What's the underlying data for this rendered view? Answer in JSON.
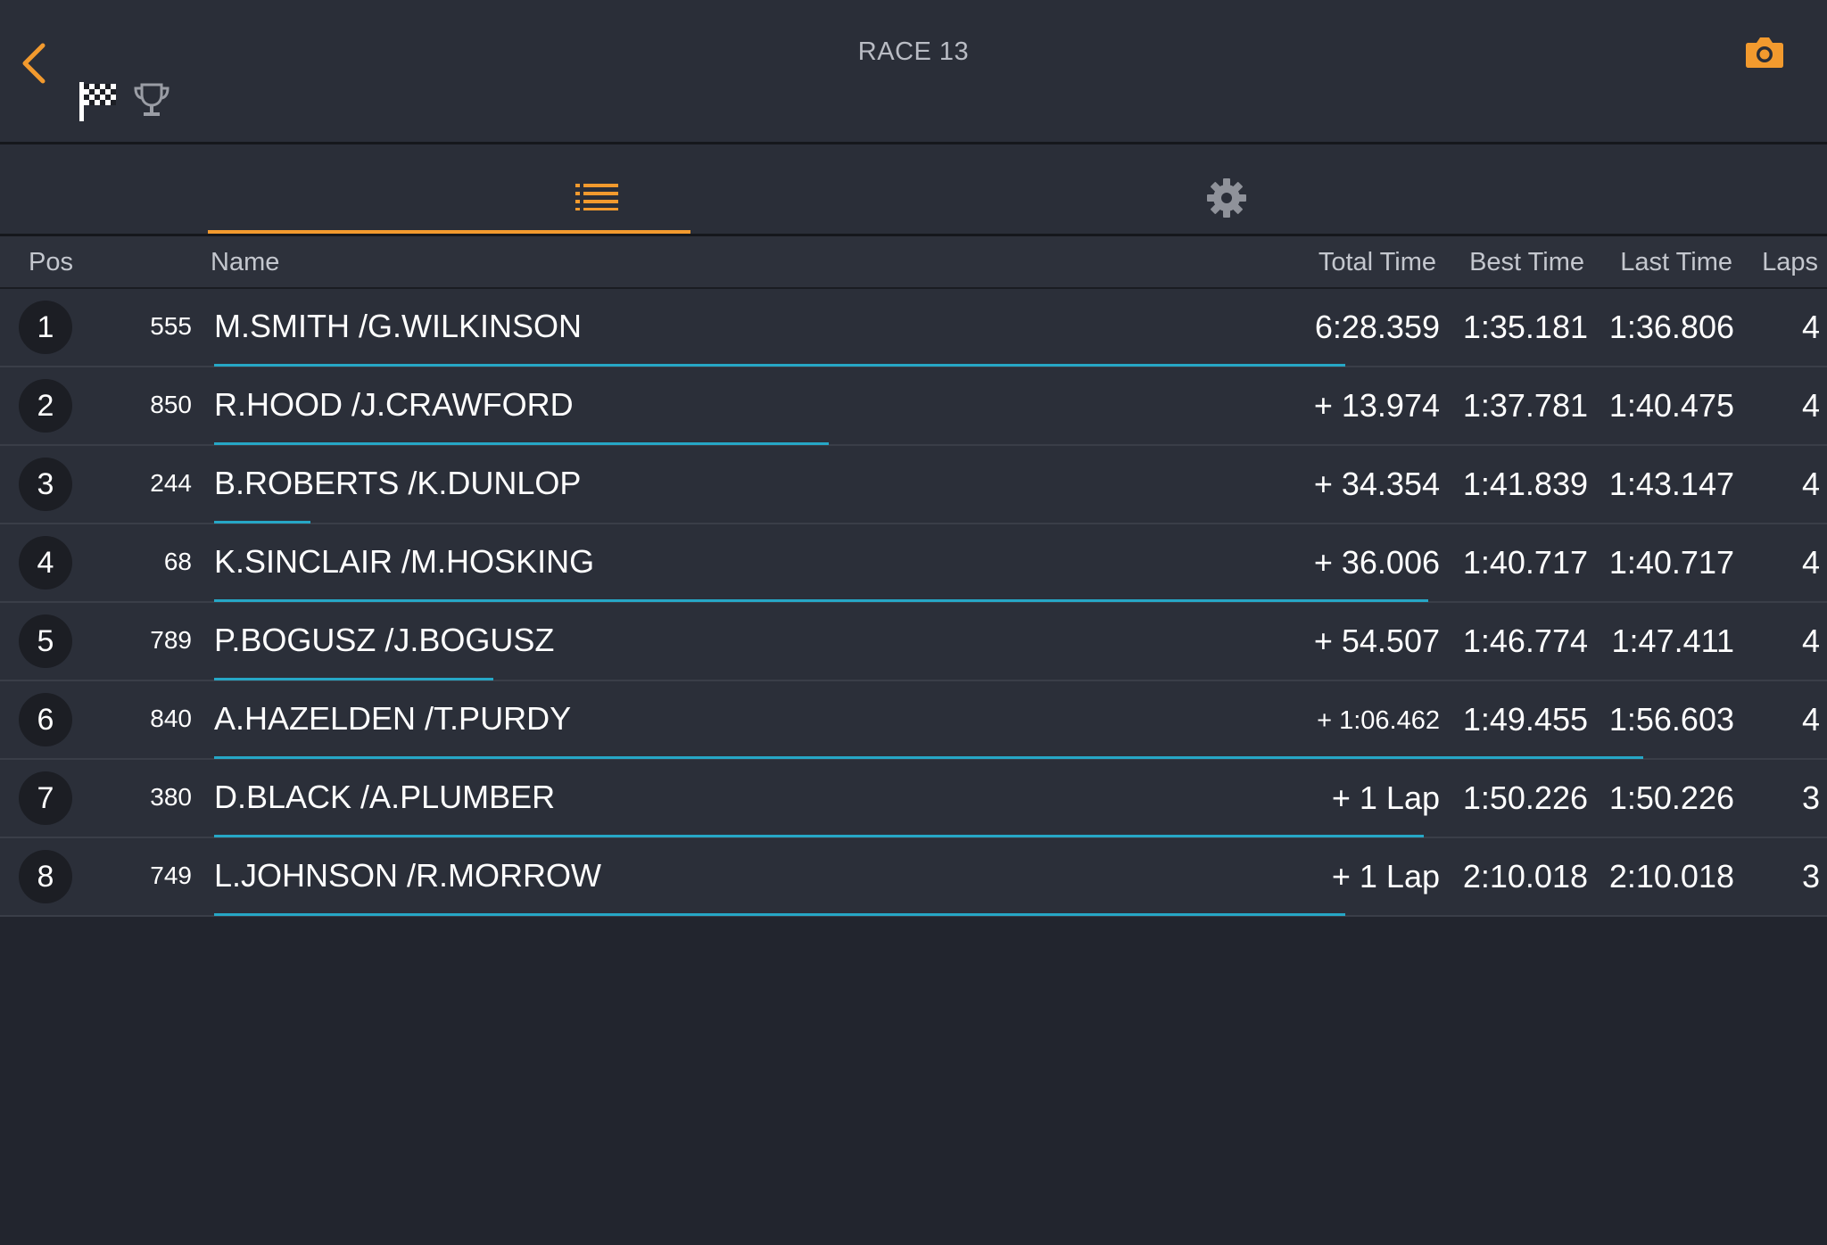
{
  "header": {
    "title": "RACE 13",
    "accent_color": "#f29a2e",
    "icons": [
      "back-chevron-icon",
      "checkered-flag-icon",
      "trophy-icon",
      "camera-icon"
    ]
  },
  "tabs": [
    {
      "icon": "list-icon",
      "active": true
    },
    {
      "icon": "gear-icon",
      "active": false
    }
  ],
  "columns": {
    "pos": "Pos",
    "name": "Name",
    "total": "Total Time",
    "best": "Best Time",
    "last": "Last Time",
    "laps": "Laps"
  },
  "rows": [
    {
      "pos": "1",
      "num": "555",
      "name": "M.SMITH /G.WILKINSON",
      "total": "6:28.359",
      "best": "1:35.181",
      "last": "1:36.806",
      "laps": "4",
      "progress": 0.705
    },
    {
      "pos": "2",
      "num": "850",
      "name": "R.HOOD /J.CRAWFORD",
      "total": "+ 13.974",
      "best": "1:37.781",
      "last": "1:40.475",
      "laps": "4",
      "progress": 0.383
    },
    {
      "pos": "3",
      "num": "244",
      "name": "B.ROBERTS /K.DUNLOP",
      "total": "+ 34.354",
      "best": "1:41.839",
      "last": "1:43.147",
      "laps": "4",
      "progress": 0.06
    },
    {
      "pos": "4",
      "num": "68",
      "name": "K.SINCLAIR /M.HOSKING",
      "total": "+ 36.006",
      "best": "1:40.717",
      "last": "1:40.717",
      "laps": "4",
      "progress": 0.757
    },
    {
      "pos": "5",
      "num": "789",
      "name": "P.BOGUSZ /J.BOGUSZ",
      "total": "+ 54.507",
      "best": "1:46.774",
      "last": "1:47.411",
      "laps": "4",
      "progress": 0.174
    },
    {
      "pos": "6",
      "num": "840",
      "name": "A.HAZELDEN /T.PURDY",
      "total": "+ 1:06.462",
      "best": "1:49.455",
      "last": "1:56.603",
      "laps": "4",
      "progress": 0.891
    },
    {
      "pos": "7",
      "num": "380",
      "name": "D.BLACK /A.PLUMBER",
      "total": "+ 1 Lap",
      "best": "1:50.226",
      "last": "1:50.226",
      "laps": "3",
      "progress": 0.754
    },
    {
      "pos": "8",
      "num": "749",
      "name": "L.JOHNSON /R.MORROW",
      "total": "+ 1 Lap",
      "best": "2:10.018",
      "last": "2:10.018",
      "laps": "3",
      "progress": 0.705
    }
  ]
}
